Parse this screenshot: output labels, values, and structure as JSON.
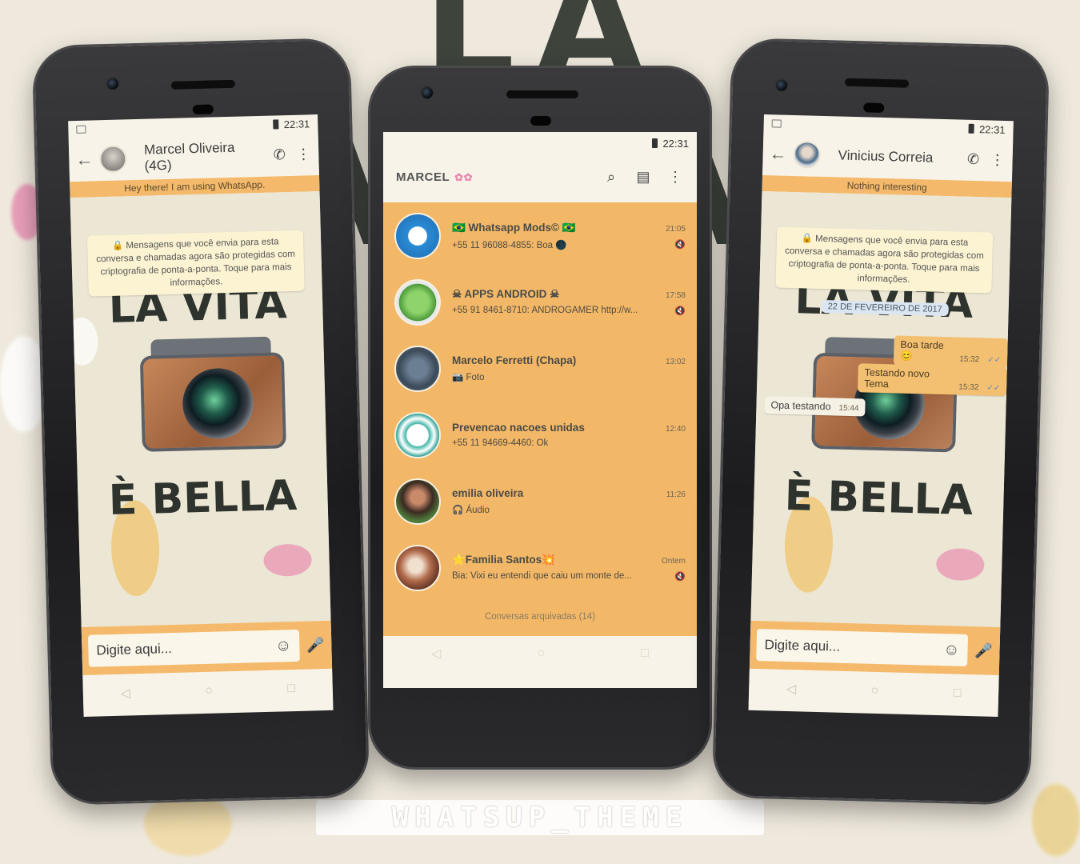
{
  "background": {
    "title": "LA VITA",
    "watermark": "WHATSUP_THEME"
  },
  "status_bar": {
    "time": "22:31"
  },
  "left_phone": {
    "contact_name": "Marcel Oliveira (4G)",
    "status": "Hey there! I am using WhatsApp.",
    "encryption_notice": "Mensagens que você envia para esta conversa e chamadas agora são protegidas com criptografia de ponta-a-ponta. Toque para mais informações.",
    "wallpaper_top": "LA VITA",
    "wallpaper_bottom": "È BELLA",
    "input_placeholder": "Digite aqui..."
  },
  "center_phone": {
    "app_title": "MARCEL",
    "chats": [
      {
        "name": "🇧🇷 Whatsapp Mods© 🇧🇷",
        "message": "+55 11 96088-4855: Boa 🌑",
        "time": "21:05",
        "muted": true
      },
      {
        "name": "☠ APPS ANDROID ☠",
        "message": "+55 91 8461-8710: ANDROGAMER http://w...",
        "time": "17:58",
        "muted": true
      },
      {
        "name": "Marcelo Ferretti (Chapa)",
        "message": "📷 Foto",
        "time": "13:02",
        "muted": false
      },
      {
        "name": "Prevencao nacoes unidas",
        "message": "+55 11 94669-4460: Ok",
        "time": "12:40",
        "muted": false
      },
      {
        "name": "emilia oliveira",
        "message": "🎧 Áudio",
        "time": "11:26",
        "muted": false
      },
      {
        "name": "⭐Familia Santos💥",
        "message": "Bia: Vixi eu entendi que caiu um monte de...",
        "time": "Ontem",
        "muted": true
      }
    ],
    "archived": "Conversas arquivadas (14)"
  },
  "right_phone": {
    "contact_name": "Vinicius Correia",
    "status": "Nothing interesting",
    "encryption_notice": "Mensagens que você envia para esta conversa e chamadas agora são protegidas com criptografia de ponta-a-ponta. Toque para mais informações.",
    "date_chip": "22 DE FEVEREIRO DE 2017",
    "messages": [
      {
        "text": "Boa tarde 😊",
        "time": "15:32",
        "direction": "out"
      },
      {
        "text": "Testando novo Tema",
        "time": "15:32",
        "direction": "out"
      },
      {
        "text": "Opa testando",
        "time": "15:44",
        "direction": "in"
      }
    ],
    "wallpaper_top": "LA VITA",
    "wallpaper_bottom": "È BELLA",
    "input_placeholder": "Digite aqui..."
  },
  "colors": {
    "accent_orange": "#f2b868",
    "screen_cream": "#f8f3e8",
    "phone_body": "#1c1c1e"
  }
}
